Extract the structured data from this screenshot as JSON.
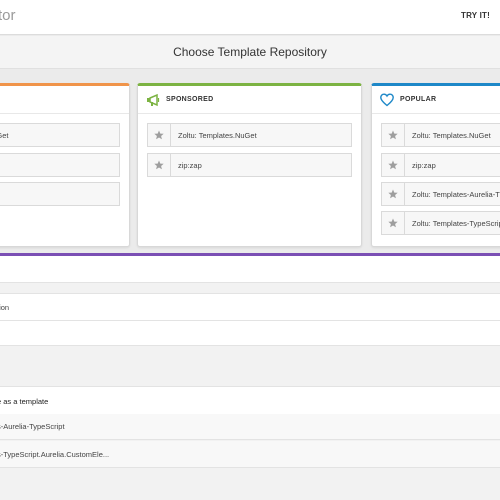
{
  "header": {
    "title_fragment": "tor",
    "try_label": "TRY IT!"
  },
  "main": {
    "title": "Choose Template Repository"
  },
  "cards": {
    "left": {
      "accent": "#f0944a",
      "items": [
        "s.NuGet"
      ]
    },
    "sponsored": {
      "accent": "#7cb342",
      "heading": "SPONSORED",
      "icon": "megaphone-icon",
      "items": [
        "Zoltu: Templates.NuGet",
        "zip:zap"
      ]
    },
    "popular": {
      "accent": "#1e88c8",
      "heading": "POPULAR",
      "icon": "heart-icon",
      "items": [
        "Zoltu: Templates.NuGet",
        "zip:zap",
        "Zoltu: Templates-Aurelia-T",
        "Zoltu: Templates-TypeScrip"
      ]
    }
  },
  "lower": {
    "accent": "#7b4fb4",
    "row_option": "tion",
    "row_template_heading": "e as a template",
    "row_item_1": "s-Aurelia-TypeScript",
    "row_item_2": "s-TypeScript.Aurelia.CustomEle..."
  }
}
